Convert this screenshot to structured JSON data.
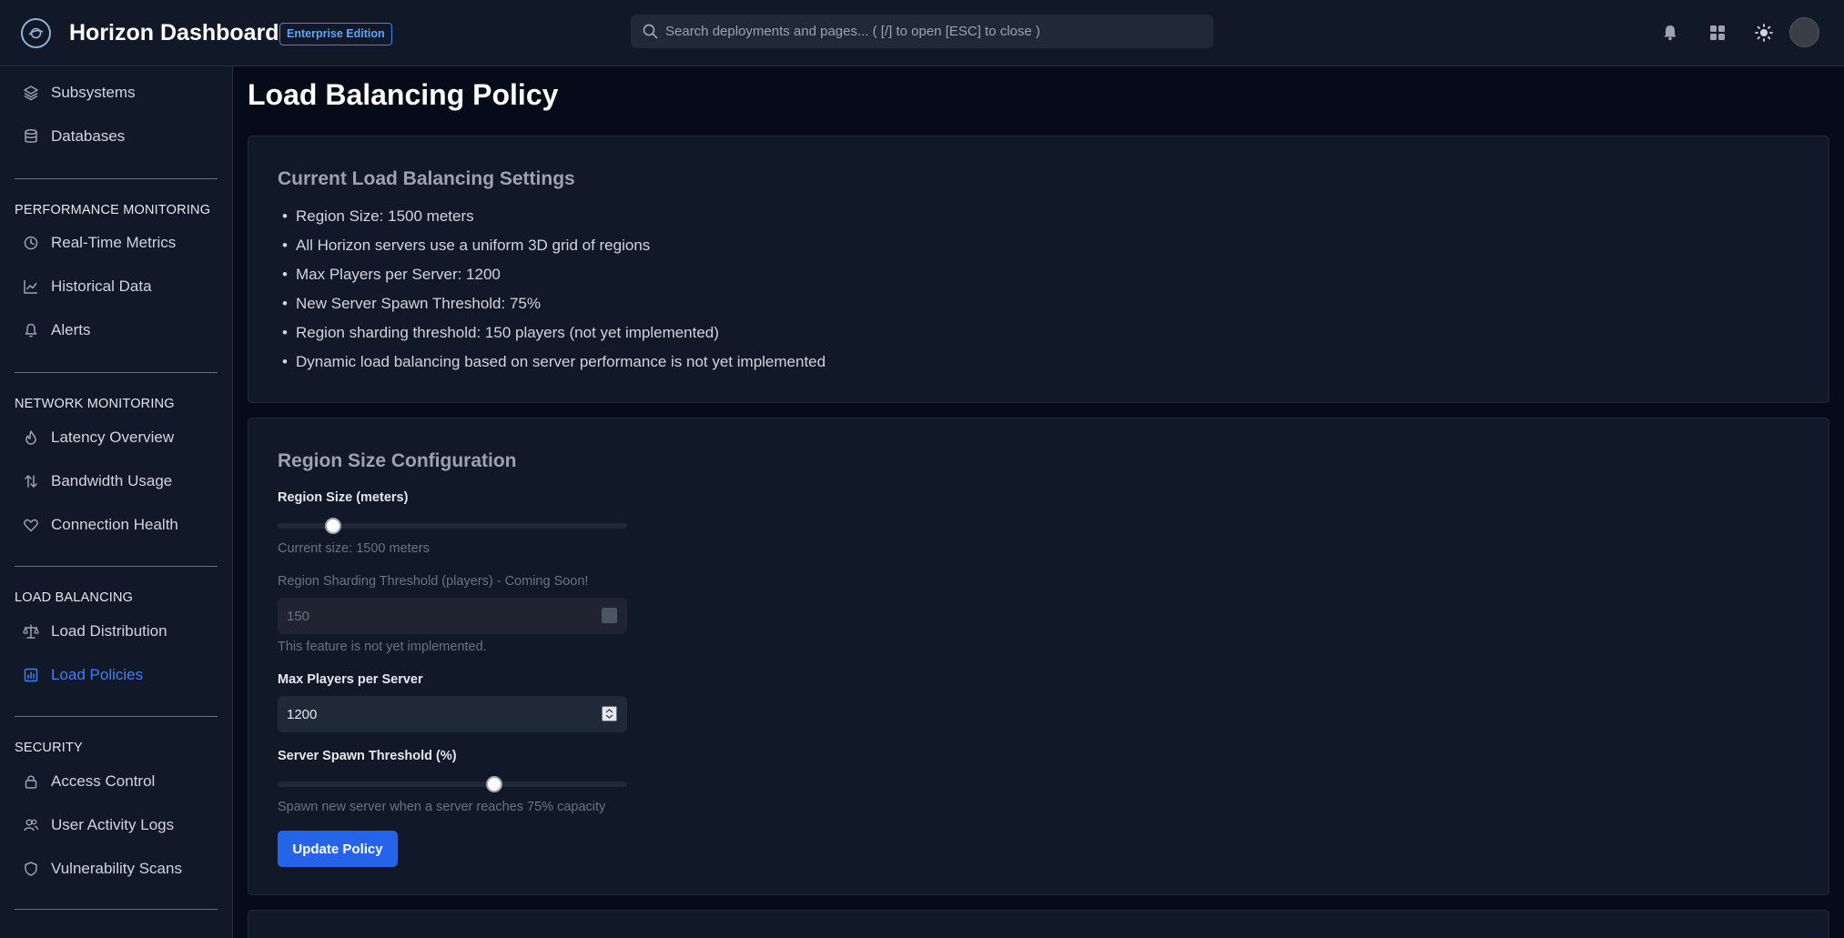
{
  "header": {
    "app_title": "Horizon Dashboard",
    "edition_badge": "Enterprise Edition",
    "search_placeholder": "Search deployments and pages... ( [/] to open [ESC] to close )"
  },
  "sidebar": {
    "top_items": [
      {
        "label": "Subsystems",
        "icon": "layers-icon"
      },
      {
        "label": "Databases",
        "icon": "database-icon"
      }
    ],
    "sections": [
      {
        "title": "PERFORMANCE MONITORING",
        "items": [
          {
            "label": "Real-Time Metrics",
            "icon": "clock-icon"
          },
          {
            "label": "Historical Data",
            "icon": "line-chart-icon"
          },
          {
            "label": "Alerts",
            "icon": "bell-icon"
          }
        ]
      },
      {
        "title": "NETWORK MONITORING",
        "items": [
          {
            "label": "Latency Overview",
            "icon": "flame-icon"
          },
          {
            "label": "Bandwidth Usage",
            "icon": "arrows-up-down-icon"
          },
          {
            "label": "Connection Health",
            "icon": "heart-icon"
          }
        ]
      },
      {
        "title": "LOAD BALANCING",
        "items": [
          {
            "label": "Load Distribution",
            "icon": "scale-icon"
          },
          {
            "label": "Load Policies",
            "icon": "policy-chart-icon",
            "active": true
          }
        ]
      },
      {
        "title": "SECURITY",
        "items": [
          {
            "label": "Access Control",
            "icon": "lock-icon"
          },
          {
            "label": "User Activity Logs",
            "icon": "users-icon"
          },
          {
            "label": "Vulnerability Scans",
            "icon": "shield-icon"
          }
        ]
      }
    ],
    "active_color": "#3b82f6"
  },
  "main": {
    "page_title": "Load Balancing Policy",
    "current_settings": {
      "title": "Current Load Balancing Settings",
      "bullets": [
        "Region Size: 1500 meters",
        "All Horizon servers use a uniform 3D grid of regions",
        "Max Players per Server: 1200",
        "New Server Spawn Threshold: 75%",
        "Region sharding threshold: 150 players (not yet implemented)",
        "Dynamic load balancing based on server performance is not yet implemented"
      ]
    },
    "region_config": {
      "title": "Region Size Configuration",
      "region_size_label": "Region Size (meters)",
      "region_size_value_fraction": 0.16,
      "region_size_hint": "Current size: 1500 meters",
      "sharding_label": "Region Sharding Threshold (players) - Coming Soon!",
      "sharding_value": "150",
      "sharding_hint": "This feature is not yet implemented.",
      "max_players_label": "Max Players per Server",
      "max_players_value": "1200",
      "spawn_label": "Server Spawn Threshold (%)",
      "spawn_value_fraction": 0.62,
      "spawn_hint": "Spawn new server when a server reaches 75% capacity",
      "update_button": "Update Policy"
    }
  }
}
